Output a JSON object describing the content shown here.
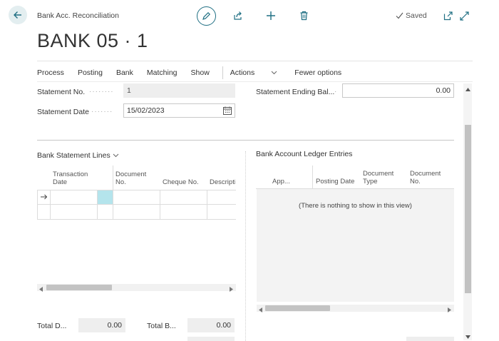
{
  "header": {
    "caption": "Bank Acc. Reconciliation",
    "title": "BANK 05 · 1",
    "saved_label": "Saved"
  },
  "actions": {
    "items": [
      "Process",
      "Posting",
      "Bank",
      "Matching",
      "Show"
    ],
    "more_label": "Actions",
    "fewer_label": "Fewer options"
  },
  "fields": {
    "statement_no_label": "Statement No.",
    "statement_no_value": "1",
    "statement_date_label": "Statement Date",
    "statement_date_value": "15/02/2023",
    "ending_balance_label": "Statement Ending Bal...",
    "ending_balance_value": "0.00"
  },
  "bank_statement_lines": {
    "title": "Bank Statement Lines",
    "columns": [
      "Transaction Date",
      "Document No.",
      "Cheque No.",
      "Descriptio"
    ]
  },
  "ledger_entries": {
    "title": "Bank Account Ledger Entries",
    "columns": [
      "App...",
      "Posting Date",
      "Document Type",
      "Document No."
    ],
    "empty_text": "(There is nothing to show in this view)"
  },
  "totals": {
    "total_d_label": "Total D...",
    "total_d_value": "0.00",
    "total_b_label": "Total B...",
    "total_b_value": "0.00"
  },
  "colors": {
    "accent": "#1f6f83",
    "selected_cell": "#b4e4ec"
  }
}
